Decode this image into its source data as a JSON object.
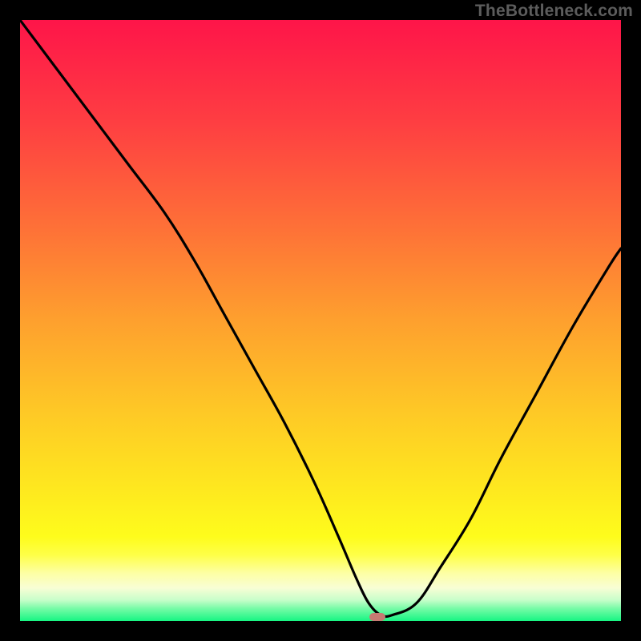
{
  "watermark": "TheBottleneck.com",
  "marker": {
    "x_pct": 59.5,
    "y_pct": 99.3,
    "color": "#c77a72"
  },
  "gradient_stops": [
    {
      "offset": 0,
      "color": "#fe1549"
    },
    {
      "offset": 17,
      "color": "#fe3e42"
    },
    {
      "offset": 35,
      "color": "#fe7237"
    },
    {
      "offset": 50,
      "color": "#fea02e"
    },
    {
      "offset": 65,
      "color": "#fec826"
    },
    {
      "offset": 78,
      "color": "#fee81f"
    },
    {
      "offset": 86,
      "color": "#fefc1c"
    },
    {
      "offset": 89,
      "color": "#feff47"
    },
    {
      "offset": 92,
      "color": "#fdffa3"
    },
    {
      "offset": 94.5,
      "color": "#f8fed5"
    },
    {
      "offset": 96.5,
      "color": "#c8feca"
    },
    {
      "offset": 98,
      "color": "#73fba5"
    },
    {
      "offset": 100,
      "color": "#17f583"
    }
  ],
  "chart_data": {
    "type": "line",
    "title": "",
    "xlabel": "",
    "ylabel": "",
    "xlim": [
      0,
      100
    ],
    "ylim": [
      0,
      100
    ],
    "x": [
      0,
      6,
      12,
      18,
      24,
      29,
      34,
      39,
      44,
      49,
      53,
      56,
      58,
      60,
      62,
      66,
      70,
      75,
      80,
      86,
      92,
      98,
      100
    ],
    "y": [
      100,
      92,
      84,
      76,
      68,
      60,
      51,
      42,
      33,
      23,
      14,
      7,
      3,
      1,
      1,
      3,
      9,
      17,
      27,
      38,
      49,
      59,
      62
    ],
    "series": [
      {
        "name": "bottleneck-curve",
        "x": [
          0,
          6,
          12,
          18,
          24,
          29,
          34,
          39,
          44,
          49,
          53,
          56,
          58,
          60,
          62,
          66,
          70,
          75,
          80,
          86,
          92,
          98,
          100
        ],
        "y": [
          100,
          92,
          84,
          76,
          68,
          60,
          51,
          42,
          33,
          23,
          14,
          7,
          3,
          1,
          1,
          3,
          9,
          17,
          27,
          38,
          49,
          59,
          62
        ]
      }
    ],
    "annotations": [
      {
        "type": "marker",
        "x": 59.5,
        "y": 0.7,
        "label": "optimal-point"
      }
    ]
  }
}
